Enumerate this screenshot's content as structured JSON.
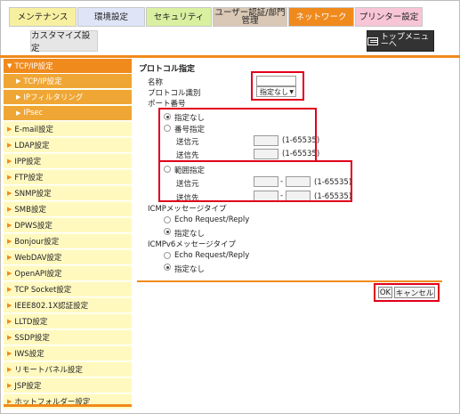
{
  "tabs": {
    "maintenance": "メンテナンス",
    "environment": "環境設定",
    "security": "セキュリティ",
    "user_auth": "ユーザー認証/部門管理",
    "network": "ネットワーク",
    "printer": "プリンター設定"
  },
  "subtab": {
    "customize": "カスタマイズ設定"
  },
  "topmenu": {
    "label": "トップメニューへ"
  },
  "sidebar": {
    "items": [
      {
        "label": "TCP/IP設定",
        "state": "active"
      },
      {
        "label": "TCP/IP設定",
        "state": "sub"
      },
      {
        "label": "IPフィルタリング",
        "state": "sub"
      },
      {
        "label": "IPsec",
        "state": "sub"
      },
      {
        "label": "E-mail設定"
      },
      {
        "label": "LDAP設定"
      },
      {
        "label": "IPP設定"
      },
      {
        "label": "FTP設定"
      },
      {
        "label": "SNMP設定"
      },
      {
        "label": "SMB設定"
      },
      {
        "label": "DPWS設定"
      },
      {
        "label": "Bonjour設定"
      },
      {
        "label": "WebDAV設定"
      },
      {
        "label": "OpenAPI設定"
      },
      {
        "label": "TCP Socket設定"
      },
      {
        "label": "IEEE802.1X認証設定"
      },
      {
        "label": "LLTD設定"
      },
      {
        "label": "SSDP設定"
      },
      {
        "label": "IWS設定"
      },
      {
        "label": "リモートパネル設定"
      },
      {
        "label": "JSP設定"
      },
      {
        "label": "ホットフォルダー設定"
      }
    ]
  },
  "form": {
    "title": "プロトコル指定",
    "name_label": "名称",
    "name_value": "",
    "protocol_label": "プロトコル識別",
    "protocol_value": "指定なし",
    "port_label": "ポート番号",
    "port_none": "指定なし",
    "port_number": "番号指定",
    "src": "送信元",
    "dst": "送信先",
    "range_hint": "(1-65535)",
    "port_range": "範囲指定",
    "range_dash": "-",
    "icmp_label": "ICMPメッセージタイプ",
    "echo": "Echo Request/Reply",
    "icmp_none": "指定なし",
    "icmpv6_label": "ICMPv6メッセージタイプ",
    "echo6": "Echo Request/Reply",
    "icmpv6_none": "指定なし"
  },
  "buttons": {
    "ok": "OK",
    "cancel": "キャンセル"
  },
  "colors": {
    "accent": "#f08a1c",
    "highlight": "#e0001a",
    "sidebar_bg": "#ffffe0"
  }
}
